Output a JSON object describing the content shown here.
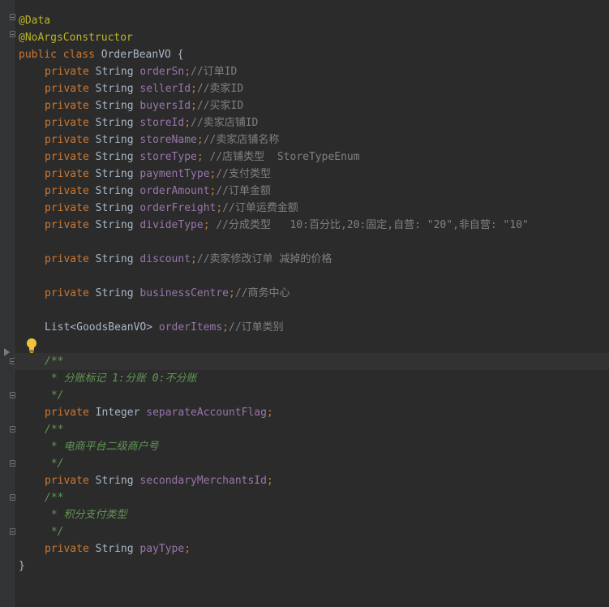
{
  "code": {
    "annotations": [
      "@Data",
      "@NoArgsConstructor"
    ],
    "class_declaration": {
      "keyword": "public class",
      "name": "OrderBeanVO {"
    },
    "fields": [
      {
        "modifier": "private",
        "type": "String",
        "name": "orderSn",
        "punct": ";",
        "comment": "//订单ID"
      },
      {
        "modifier": "private",
        "type": "String",
        "name": "sellerId",
        "punct": ";",
        "comment": "//卖家ID"
      },
      {
        "modifier": "private",
        "type": "String",
        "name": "buyersId",
        "punct": ";",
        "comment": "//买家ID"
      },
      {
        "modifier": "private",
        "type": "String",
        "name": "storeId",
        "punct": ";",
        "comment": "//卖家店铺ID"
      },
      {
        "modifier": "private",
        "type": "String",
        "name": "storeName",
        "punct": ";",
        "comment": "//卖家店铺名称"
      },
      {
        "modifier": "private",
        "type": "String",
        "name": "storeType",
        "punct": "; ",
        "comment": "//店铺类型  StoreTypeEnum"
      },
      {
        "modifier": "private",
        "type": "String",
        "name": "paymentType",
        "punct": ";",
        "comment": "//支付类型"
      },
      {
        "modifier": "private",
        "type": "String",
        "name": "orderAmount",
        "punct": ";",
        "comment": "//订单金额"
      },
      {
        "modifier": "private",
        "type": "String",
        "name": "orderFreight",
        "punct": ";",
        "comment": "//订单运费金额"
      },
      {
        "modifier": "private",
        "type": "String",
        "name": "divideType",
        "punct": "; ",
        "comment": "//分成类型   10:百分比,20:固定,自营: \"20\",非自营: \"10\""
      },
      {
        "modifier": "private",
        "type": "String",
        "name": "discount",
        "punct": ";",
        "comment": "//卖家修改订单 减掉的价格"
      },
      {
        "modifier": "private",
        "type": "String",
        "name": "businessCentre",
        "punct": ";",
        "comment": "//商务中心"
      },
      {
        "modifier": "",
        "type": "List<GoodsBeanVO>",
        "name": "orderItems",
        "punct": ";",
        "comment": "//订单类别"
      }
    ],
    "doc_fields": [
      {
        "doc_open": "/**",
        "doc_text": " * 分账标记 1:分账 0:不分账",
        "doc_close": " */",
        "modifier": "private",
        "type": "Integer",
        "name": "separateAccountFlag",
        "punct": ";"
      },
      {
        "doc_open": "/**",
        "doc_text": " * 电商平台二级商户号",
        "doc_close": " */",
        "modifier": "private",
        "type": "String",
        "name": "secondaryMerchantsId",
        "punct": ";"
      },
      {
        "doc_open": "/**",
        "doc_text": " * 积分支付类型",
        "doc_close": " */",
        "modifier": "private",
        "type": "String",
        "name": "payType",
        "punct": ";"
      }
    ],
    "closing_brace": "}"
  },
  "icons": {
    "intention": "lightbulb-icon",
    "fold": "fold-marker-icon",
    "fold_arrow": "fold-arrow-icon"
  },
  "colors": {
    "background": "#2b2b2b",
    "keyword": "#cc7832",
    "annotation": "#bbb529",
    "field": "#9876aa",
    "comment": "#808080",
    "doc_comment": "#629755",
    "text": "#a9b7c6",
    "caret_line": "#323232"
  }
}
